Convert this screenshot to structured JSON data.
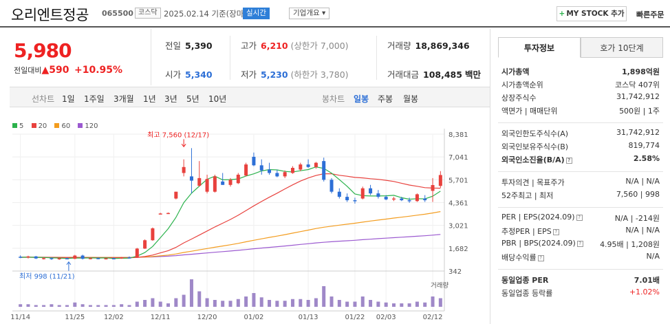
{
  "header": {
    "stock_name": "오리엔트정공",
    "stock_code": "065500",
    "market_badge": "코스닥",
    "date_text": "2025.02.14 기준(장마감)",
    "live_label": "실시간",
    "corp_label": "기업개요 ▾",
    "mystock_label": "MY STOCK 추가",
    "mystock_plus": "+",
    "quick_order": "빠른주문"
  },
  "price": {
    "current": "5,980",
    "change_label": "전일대비",
    "change_arrow": "▲",
    "change_value": "590",
    "change_pct": "+10.95%"
  },
  "summary": {
    "prev_label": "전일",
    "prev_value": "5,390",
    "high_label": "고가",
    "high_value": "6,210",
    "high_sub": "(상한가 7,000)",
    "volume_label": "거래량",
    "volume_value": "18,869,346",
    "open_label": "시가",
    "open_value": "5,340",
    "low_label": "저가",
    "low_value": "5,230",
    "low_sub": "(하한가 3,780)",
    "amount_label": "거래대금",
    "amount_value": "108,485",
    "amount_unit": "백만"
  },
  "periods": {
    "line_chart_label": "선차트",
    "items": [
      "1일",
      "1주일",
      "3개월",
      "1년",
      "3년",
      "5년",
      "10년"
    ],
    "candle_label": "봉차트",
    "candle_items": [
      "일봉",
      "주봉",
      "월봉"
    ],
    "selected_candle": "일봉"
  },
  "chart_data": {
    "type": "candlestick",
    "legend": [
      {
        "name": "5",
        "color": "#2bb24c"
      },
      {
        "name": "20",
        "color": "#e8413d"
      },
      {
        "name": "60",
        "color": "#f39c1e"
      },
      {
        "name": "120",
        "color": "#9b59d0"
      }
    ],
    "y_ticks": [
      "8,381",
      "7,041",
      "5,701",
      "4,361",
      "3,021",
      "1,682",
      "342"
    ],
    "ylim": [
      342,
      8381
    ],
    "x_ticks": [
      "11/14",
      "11/25",
      "12/02",
      "12/11",
      "12/20",
      "01/02",
      "01/13",
      "01/22",
      "02/03",
      "02/12"
    ],
    "x_tick_index": [
      0,
      7,
      12,
      18,
      24,
      30,
      37,
      43,
      47,
      53
    ],
    "annotations": {
      "high_text": "최고 7,560 (12/17)",
      "high_index": 21,
      "high_value": 7560,
      "low_text": "최저 998 (11/21)",
      "low_index": 4,
      "low_value": 998
    },
    "volume_label": "거래량",
    "candles": [
      {
        "o": 1180,
        "h": 1260,
        "l": 1100,
        "c": 1150
      },
      {
        "o": 1150,
        "h": 1240,
        "l": 1080,
        "c": 1200
      },
      {
        "o": 1200,
        "h": 1230,
        "l": 1050,
        "c": 1080
      },
      {
        "o": 1080,
        "h": 1150,
        "l": 1020,
        "c": 1100
      },
      {
        "o": 1100,
        "h": 1130,
        "l": 998,
        "c": 1050
      },
      {
        "o": 1050,
        "h": 1120,
        "l": 1000,
        "c": 1090
      },
      {
        "o": 1090,
        "h": 1140,
        "l": 1030,
        "c": 1060
      },
      {
        "o": 1060,
        "h": 1290,
        "l": 1040,
        "c": 1250
      },
      {
        "o": 1250,
        "h": 1300,
        "l": 1020,
        "c": 1060
      },
      {
        "o": 1060,
        "h": 1120,
        "l": 1030,
        "c": 1100
      },
      {
        "o": 1100,
        "h": 1140,
        "l": 1040,
        "c": 1060
      },
      {
        "o": 1060,
        "h": 1110,
        "l": 1020,
        "c": 1090
      },
      {
        "o": 1090,
        "h": 1140,
        "l": 1050,
        "c": 1080
      },
      {
        "o": 1080,
        "h": 1170,
        "l": 1060,
        "c": 1140
      },
      {
        "o": 1140,
        "h": 1200,
        "l": 1090,
        "c": 1120
      },
      {
        "o": 1120,
        "h": 1700,
        "l": 1110,
        "c": 1660
      },
      {
        "o": 1660,
        "h": 2200,
        "l": 1640,
        "c": 2150
      },
      {
        "o": 2150,
        "h": 2900,
        "l": 2120,
        "c": 2850
      },
      {
        "o": 3700,
        "h": 3760,
        "l": 3680,
        "c": 3720
      },
      {
        "o": 3720,
        "h": 3780,
        "l": 3690,
        "c": 3750
      },
      {
        "o": 4600,
        "h": 5000,
        "l": 4550,
        "c": 5000
      },
      {
        "o": 6100,
        "h": 6900,
        "l": 5900,
        "c": 6450
      },
      {
        "o": 5900,
        "h": 7560,
        "l": 4900,
        "c": 5650
      },
      {
        "o": 5350,
        "h": 6800,
        "l": 5300,
        "c": 5800
      },
      {
        "o": 5000,
        "h": 6000,
        "l": 4900,
        "c": 5750
      },
      {
        "o": 5000,
        "h": 6000,
        "l": 4950,
        "c": 5900
      },
      {
        "o": 5600,
        "h": 6100,
        "l": 5400,
        "c": 5400
      },
      {
        "o": 5400,
        "h": 5800,
        "l": 5300,
        "c": 5700
      },
      {
        "o": 5500,
        "h": 6100,
        "l": 5450,
        "c": 6000
      },
      {
        "o": 5950,
        "h": 6700,
        "l": 5900,
        "c": 6600
      },
      {
        "o": 7050,
        "h": 7300,
        "l": 6500,
        "c": 6550
      },
      {
        "o": 6550,
        "h": 6900,
        "l": 6000,
        "c": 6250
      },
      {
        "o": 6300,
        "h": 6700,
        "l": 6000,
        "c": 6100
      },
      {
        "o": 6100,
        "h": 6300,
        "l": 5850,
        "c": 5900
      },
      {
        "o": 5900,
        "h": 6250,
        "l": 5800,
        "c": 6150
      },
      {
        "o": 6100,
        "h": 6500,
        "l": 6050,
        "c": 6400
      },
      {
        "o": 6300,
        "h": 6700,
        "l": 6200,
        "c": 6600
      },
      {
        "o": 6600,
        "h": 6900,
        "l": 6400,
        "c": 6450
      },
      {
        "o": 6450,
        "h": 6750,
        "l": 6350,
        "c": 6700
      },
      {
        "o": 6800,
        "h": 7000,
        "l": 5600,
        "c": 5700
      },
      {
        "o": 5700,
        "h": 5800,
        "l": 4900,
        "c": 5000
      },
      {
        "o": 5000,
        "h": 5200,
        "l": 4600,
        "c": 4700
      },
      {
        "o": 4700,
        "h": 4900,
        "l": 4400,
        "c": 4500
      },
      {
        "o": 4500,
        "h": 4650,
        "l": 4300,
        "c": 4450
      },
      {
        "o": 4600,
        "h": 5300,
        "l": 4550,
        "c": 5200
      },
      {
        "o": 5200,
        "h": 5400,
        "l": 4800,
        "c": 4900
      },
      {
        "o": 4900,
        "h": 5100,
        "l": 4600,
        "c": 4700
      },
      {
        "o": 4700,
        "h": 4800,
        "l": 4500,
        "c": 4550
      },
      {
        "o": 4550,
        "h": 4700,
        "l": 4450,
        "c": 4600
      },
      {
        "o": 4600,
        "h": 4700,
        "l": 4450,
        "c": 4500
      },
      {
        "o": 4500,
        "h": 4650,
        "l": 4350,
        "c": 4450
      },
      {
        "o": 4450,
        "h": 4900,
        "l": 4400,
        "c": 4850
      },
      {
        "o": 4600,
        "h": 4800,
        "l": 4400,
        "c": 4500
      },
      {
        "o": 5050,
        "h": 5800,
        "l": 4400,
        "c": 5390
      },
      {
        "o": 5340,
        "h": 6210,
        "l": 5230,
        "c": 5980
      }
    ],
    "volumes": [
      3,
      3,
      2,
      2,
      3,
      2,
      2,
      5,
      3,
      2,
      2,
      2,
      2,
      3,
      2,
      6,
      8,
      10,
      6,
      4,
      10,
      14,
      32,
      18,
      10,
      8,
      7,
      7,
      9,
      12,
      16,
      11,
      8,
      7,
      7,
      9,
      9,
      8,
      10,
      24,
      12,
      8,
      6,
      6,
      12,
      8,
      6,
      5,
      4,
      4,
      4,
      6,
      5,
      12,
      10
    ]
  },
  "tabs": {
    "invest_label": "투자정보",
    "order_label": "호가 10단계"
  },
  "info": {
    "market_cap": {
      "label": "시가총액",
      "value": "1,898억원"
    },
    "cap_rank": {
      "label": "시가총액순위",
      "value": "코스닥 407위"
    },
    "shares": {
      "label": "상장주식수",
      "value": "31,742,912"
    },
    "par": {
      "label": "액면가 | 매매단위",
      "value": "500원 | 1주"
    },
    "foreign_limit": {
      "label": "외국인한도주식수(A)",
      "value": "31,742,912"
    },
    "foreign_hold": {
      "label": "외국인보유주식수(B)",
      "value": "819,774"
    },
    "foreign_rate": {
      "label": "외국인소진율(B/A)",
      "value": "2.58%"
    },
    "opinion": {
      "label": "투자의견 | 목표주가",
      "value": "N/A | N/A"
    },
    "week52": {
      "label": "52주최고 | 최저",
      "value": "7,560 | 998"
    },
    "per": {
      "label": "PER | EPS(2024.09)",
      "value": "N/A | -214원"
    },
    "est_per": {
      "label": "추정PER | EPS",
      "value": "N/A | N/A"
    },
    "pbr": {
      "label": "PBR | BPS(2024.09)",
      "value": "4.95배 | 1,208원"
    },
    "dividend": {
      "label": "배당수익률",
      "value": "N/A"
    },
    "sector_per": {
      "label": "동일업종 PER",
      "value": "7.01배"
    },
    "sector_rate": {
      "label": "동일업종 등락률",
      "value": "+1.02%"
    }
  }
}
